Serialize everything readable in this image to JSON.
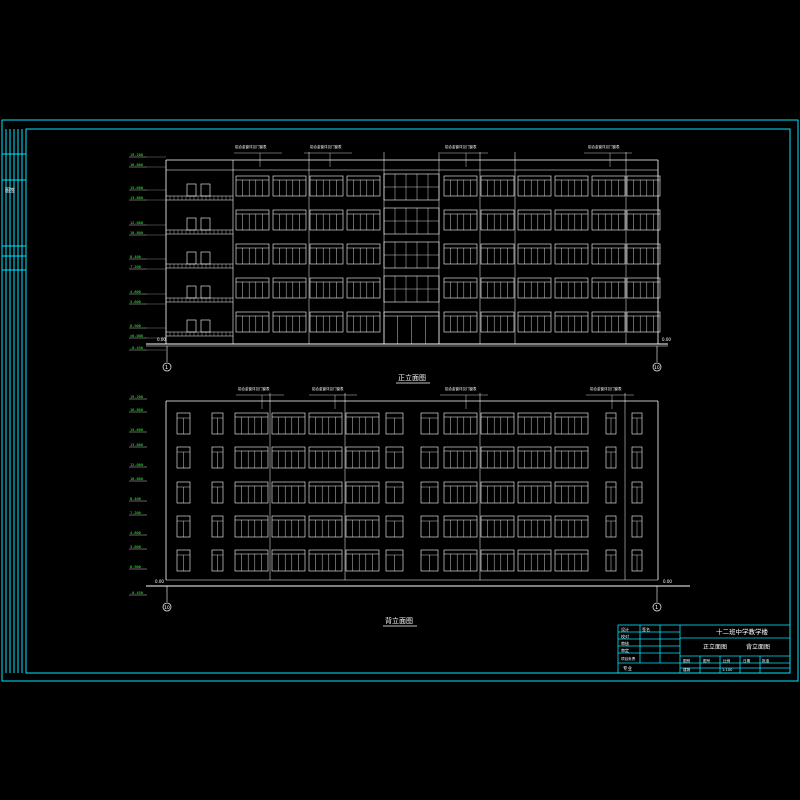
{
  "colors": {
    "background": "#000000",
    "frame": "#00e5ff",
    "lines": "#ffffff",
    "levels": "#33ff33"
  },
  "front_elevation": {
    "title": "正立面图",
    "axis_left": "1",
    "axis_right": "10",
    "ground_label_left": "0.00",
    "ground_label_right": "0.00",
    "callouts": [
      "铝合金窗详见门窗表",
      "铝合金窗详见门窗表",
      "铝合金窗详见门窗表",
      "铝合金窗详见门窗表"
    ],
    "levels": [
      "19.200",
      "16.800",
      "15.600",
      "13.800",
      "12.000",
      "10.800",
      "8.400",
      "7.200",
      "4.800",
      "3.600",
      "0.900",
      "±0.000",
      "-0.450"
    ]
  },
  "back_elevation": {
    "title": "背立面图",
    "axis_left": "10",
    "axis_right": "1",
    "ground_label_left": "0.00",
    "ground_label_right": "0.00",
    "callouts": [
      "铝合金窗详见门窗表",
      "铝合金窗详见门窗表",
      "铝合金窗详见门窗表",
      "铝合金窗详见门窗表"
    ],
    "levels": [
      "19.200",
      "16.800",
      "15.600",
      "13.800",
      "12.000",
      "10.800",
      "8.400",
      "7.200",
      "4.800",
      "3.600",
      "0.900",
      "-0.450"
    ]
  },
  "title_block": {
    "project": "十二班中学教学楼",
    "drawing_title_1": "正立面图",
    "drawing_title_2": "背立面图",
    "row_labels": [
      "设计",
      "校对",
      "审核",
      "审定",
      "项目负责"
    ],
    "bottom_left": "专业",
    "grid_labels": [
      "图别",
      "图号",
      "比例",
      "日期"
    ],
    "grid_values": [
      "建施",
      "",
      "1:100",
      ""
    ],
    "approval": "批准",
    "signature": "签名"
  },
  "left_strip": {
    "label": "图签"
  }
}
